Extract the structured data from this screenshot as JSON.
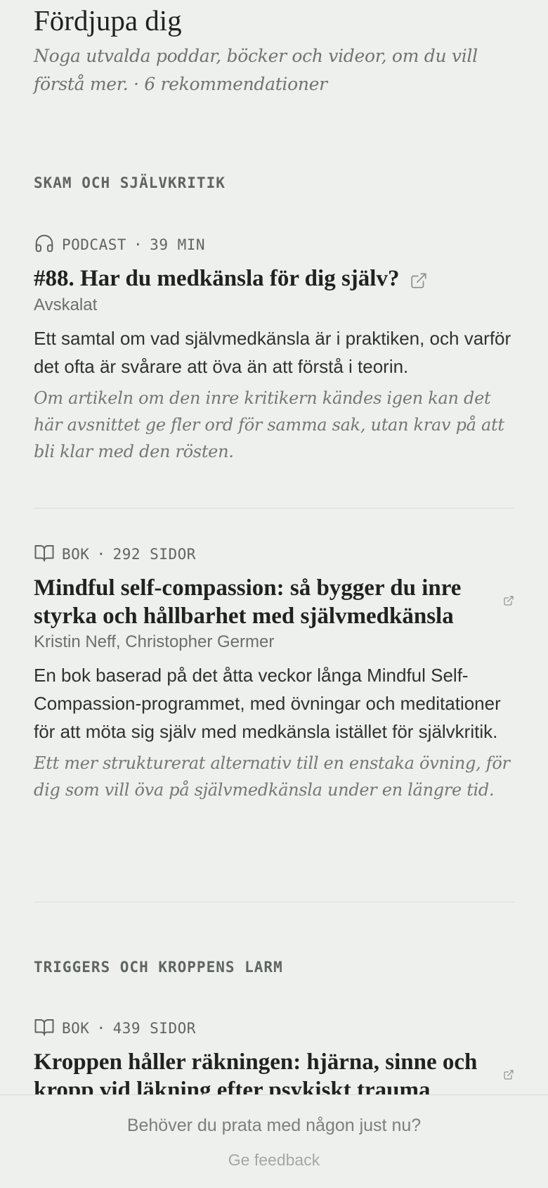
{
  "header": {
    "title": "Fördjupa dig",
    "subtitle": "Noga utvalda poddar, böcker och videor, om du vill förstå mer. · 6 rekommendationer"
  },
  "sections": [
    {
      "label": "SKAM OCH SJÄLVKRITIK",
      "items": [
        {
          "kind_icon": "headphones-icon",
          "kind": "PODCAST",
          "separator": "·",
          "length": "39 MIN",
          "title": "#88. Har du medkänsla för dig själv?",
          "author": "Avskalat",
          "description": "Ett samtal om vad självmedkänsla är i praktiken, och varför det ofta är svårare att öva än att förstå i teorin.",
          "note": "Om artikeln om den inre kritikern kändes igen kan det här avsnittet ge fler ord för samma sak, utan krav på att bli klar med den rösten."
        },
        {
          "kind_icon": "book-icon",
          "kind": "BOK",
          "separator": "·",
          "length": "292 SIDOR",
          "title": "Mindful self-compassion: så bygger du inre styrka och hållbarhet med självmedkänsla",
          "author": "Kristin Neff, Christopher Germer",
          "description": "En bok baserad på det åtta veckor långa Mindful Self-Compassion-programmet, med övningar och meditationer för att möta sig själv med medkänsla istället för självkritik.",
          "note": "Ett mer strukturerat alternativ till en enstaka övning, för dig som vill öva på självmedkänsla under en längre tid."
        }
      ]
    },
    {
      "label": "TRIGGERS OCH KROPPENS LARM",
      "items": [
        {
          "kind_icon": "book-icon",
          "kind": "BOK",
          "separator": "·",
          "length": "439 SIDOR",
          "title": "Kroppen håller räkningen: hjärna, sinne och kropp vid läkning efter psykiskt trauma"
        }
      ]
    }
  ],
  "footer": {
    "help_text": "Behöver du prata med någon just nu?",
    "feedback_label": "Ge feedback"
  },
  "colors": {
    "background": "#eef0ed",
    "text": "#1f2320",
    "muted": "#737873",
    "divider": "#d9dcd8"
  }
}
